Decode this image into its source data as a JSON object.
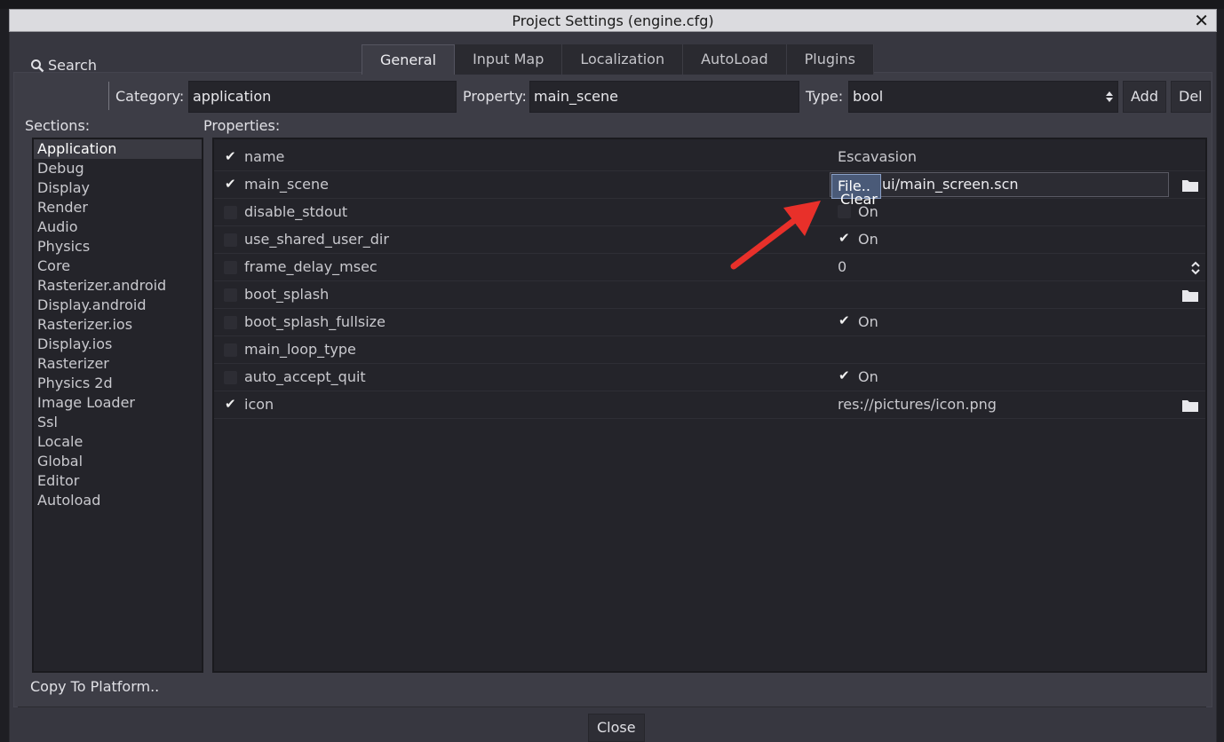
{
  "window": {
    "title": "Project Settings (engine.cfg)",
    "close_glyph": "✕"
  },
  "tabs": [
    "General",
    "Input Map",
    "Localization",
    "AutoLoad",
    "Plugins"
  ],
  "active_tab": "General",
  "toolbar": {
    "search_label": "Search",
    "category_label": "Category:",
    "category_value": "application",
    "property_label": "Property:",
    "property_value": "main_scene",
    "type_label": "Type:",
    "type_value": "bool",
    "add_label": "Add",
    "del_label": "Del"
  },
  "sections_header": "Sections:",
  "properties_header": "Properties:",
  "sections": [
    "Application",
    "Debug",
    "Display",
    "Render",
    "Audio",
    "Physics",
    "Core",
    "Rasterizer.android",
    "Display.android",
    "Rasterizer.ios",
    "Display.ios",
    "Rasterizer",
    "Physics 2d",
    "Image Loader",
    "Ssl",
    "Locale",
    "Global",
    "Editor",
    "Autoload"
  ],
  "selected_section": "Application",
  "properties": [
    {
      "name": "name",
      "enabled": true,
      "value": "Escavasion",
      "kind": "text"
    },
    {
      "name": "main_scene",
      "enabled": true,
      "value": "ui/main_screen.scn",
      "kind": "file-editing"
    },
    {
      "name": "disable_stdout",
      "enabled": false,
      "value": "On",
      "value_checked": false,
      "kind": "bool"
    },
    {
      "name": "use_shared_user_dir",
      "enabled": false,
      "value": "On",
      "value_checked": true,
      "kind": "bool"
    },
    {
      "name": "frame_delay_msec",
      "enabled": false,
      "value": "0",
      "kind": "number"
    },
    {
      "name": "boot_splash",
      "enabled": false,
      "value": "",
      "kind": "file"
    },
    {
      "name": "boot_splash_fullsize",
      "enabled": false,
      "value": "On",
      "value_checked": true,
      "kind": "bool"
    },
    {
      "name": "main_loop_type",
      "enabled": false,
      "value": "",
      "kind": "text"
    },
    {
      "name": "auto_accept_quit",
      "enabled": false,
      "value": "On",
      "value_checked": true,
      "kind": "bool"
    },
    {
      "name": "icon",
      "enabled": true,
      "value": "res://pictures/icon.png",
      "kind": "file"
    }
  ],
  "popup_menu": {
    "file_label": "File..",
    "clear_label": "Clear"
  },
  "footer": {
    "copy_to_platform": "Copy To Platform..",
    "close_label": "Close"
  },
  "annotation": {
    "arrow_color": "#e8302a"
  }
}
